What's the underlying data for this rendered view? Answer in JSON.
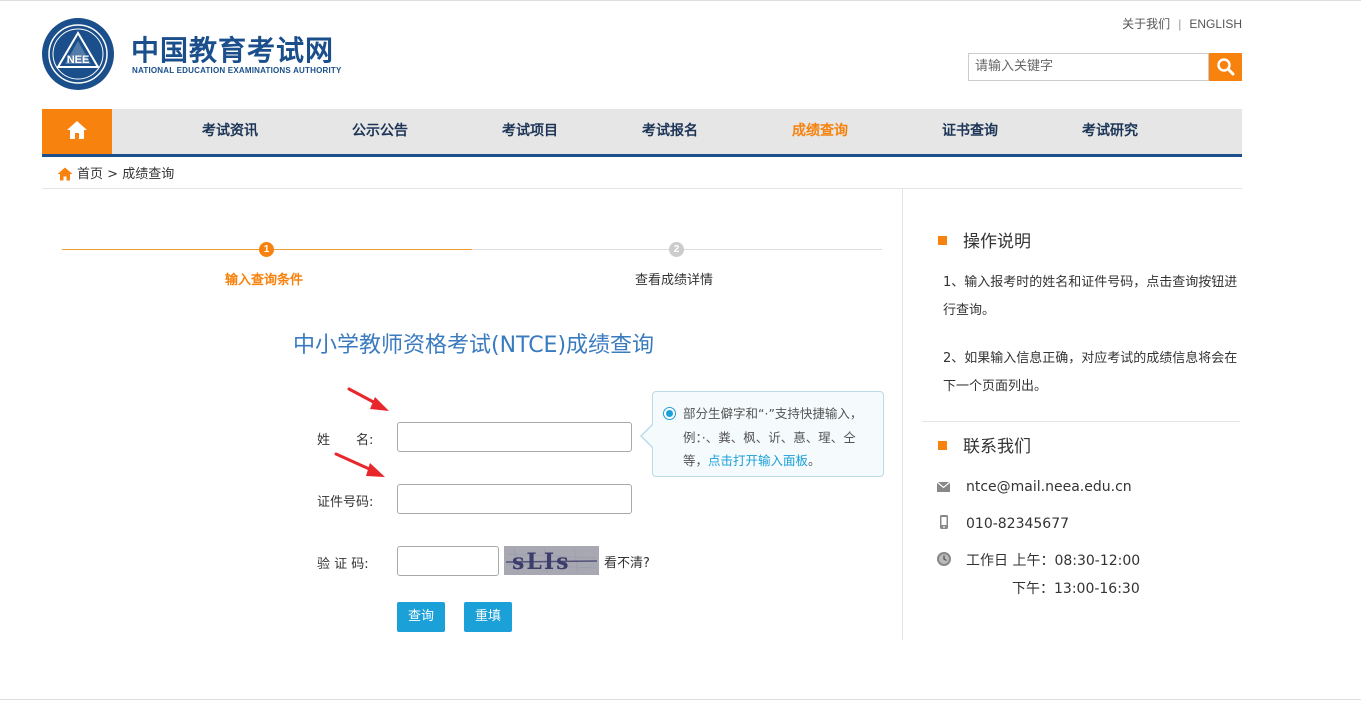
{
  "header": {
    "logo_emblem_text": "NEE",
    "logo_cn": "中国教育考试网",
    "logo_en": "NATIONAL EDUCATION EXAMINATIONS AUTHORITY",
    "about_link": "关于我们",
    "separator": "|",
    "english_link": "ENGLISH",
    "search_placeholder": "请输入关键字"
  },
  "nav": {
    "home_icon": "home-icon",
    "items": [
      {
        "label": "考试资讯"
      },
      {
        "label": "公示公告"
      },
      {
        "label": "考试项目"
      },
      {
        "label": "考试报名"
      },
      {
        "label": "成绩查询"
      },
      {
        "label": "证书查询"
      },
      {
        "label": "考试研究"
      }
    ],
    "active_index": 4
  },
  "breadcrumb": {
    "home": "首页",
    "sep": ">",
    "current": "成绩查询"
  },
  "steps": [
    {
      "num": "1",
      "label": "输入查询条件"
    },
    {
      "num": "2",
      "label": "查看成绩详情"
    }
  ],
  "form": {
    "title": "中小学教师资格考试(NTCE)成绩查询",
    "name_label": "姓　　名:",
    "id_label": "证件号码:",
    "captcha_label": "验 证 码:",
    "captcha_text": "sLIs",
    "captcha_refresh": "看不清?",
    "query_button": "查询",
    "reset_button": "重填",
    "tooltip_text": "部分生僻字和“·”支持快捷输入，例：·、粪、枫、䜣、惪、瑆、仝等，",
    "tooltip_link": "点击打开输入面板",
    "tooltip_end": "。"
  },
  "sidebar": {
    "instructions_title": "操作说明",
    "instruction_1": "1、输入报考时的姓名和证件号码，点击查询按钮进行查询。",
    "instruction_2": "2、如果输入信息正确，对应考试的成绩信息将会在下一个页面列出。",
    "contact_title": "联系我们",
    "email": "ntce@mail.neea.edu.cn",
    "phone": "010-82345677",
    "hours_am": "工作日 上午：08:30-12:00",
    "hours_pm": "下午：13:00-16:30"
  },
  "colors": {
    "accent": "#f7820e",
    "brand_blue": "#1d4f8a",
    "button_blue": "#1ba0d8",
    "title_blue": "#3a7bbf"
  }
}
